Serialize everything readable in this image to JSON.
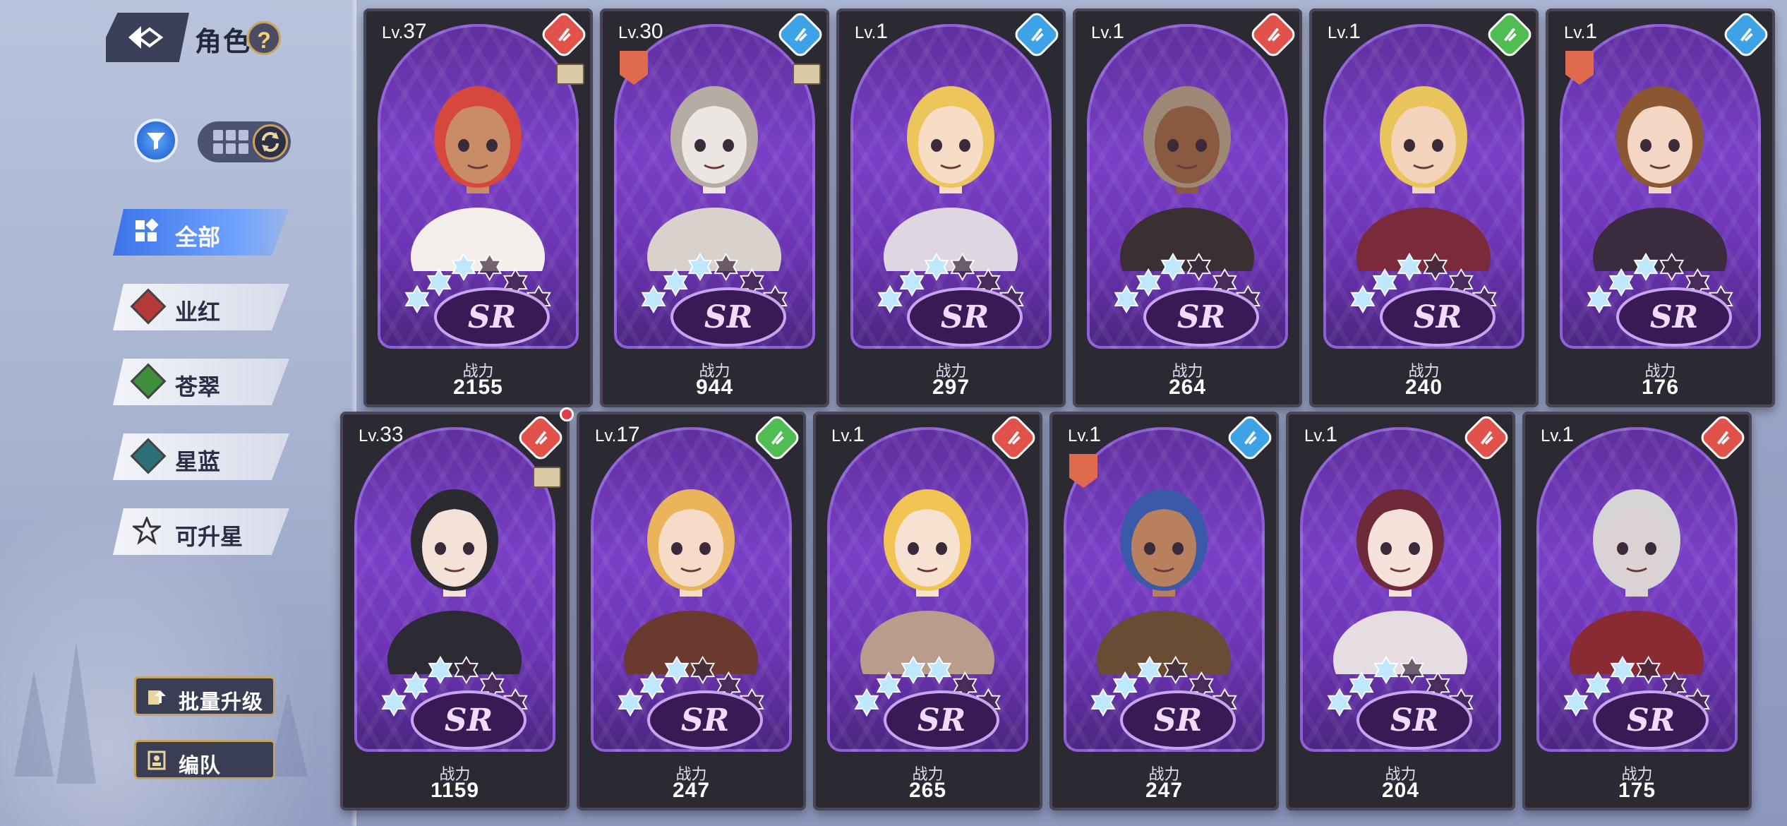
{
  "header": {
    "title": "角色",
    "help": "?"
  },
  "tabs": [
    {
      "label": "全部",
      "active": true
    },
    {
      "label": "业红",
      "color": "#b83a38"
    },
    {
      "label": "苍翠",
      "color": "#3f8f3a"
    },
    {
      "label": "星蓝",
      "color": "#2f6f7a"
    },
    {
      "label": "可升星"
    }
  ],
  "buttons": {
    "batch_upgrade": "批量升级",
    "formation": "编队"
  },
  "cards": [
    {
      "level_prefix": "Lv.",
      "level": "37",
      "element": "red",
      "has_ticket": true,
      "has_crest": false,
      "rarity": "SR",
      "stars": 3,
      "power_label": "战力",
      "power": "2155",
      "hair": "#d6473d",
      "skin": "#c98c67",
      "outfit": "#f3eee9"
    },
    {
      "level_prefix": "Lv.",
      "level": "30",
      "element": "blue",
      "has_ticket": true,
      "has_crest": true,
      "rarity": "SR",
      "stars": 3,
      "power_label": "战力",
      "power": "944",
      "hair": "#b6aca4",
      "skin": "#ece6e2",
      "outfit": "#d9d2cc"
    },
    {
      "level_prefix": "Lv.",
      "level": "1",
      "element": "blue",
      "has_ticket": false,
      "has_crest": false,
      "rarity": "SR",
      "stars": 3,
      "power_label": "战力",
      "power": "297",
      "hair": "#ecc65a",
      "skin": "#f7dcc6",
      "outfit": "#ded7e2"
    },
    {
      "level_prefix": "Lv.",
      "level": "1",
      "element": "red",
      "has_ticket": false,
      "has_crest": false,
      "rarity": "SR",
      "stars": 3,
      "power_label": "战力",
      "power": "264",
      "hair": "#9c8874",
      "skin": "#8a5a40",
      "outfit": "#3a2f32"
    },
    {
      "level_prefix": "Lv.",
      "level": "1",
      "element": "green",
      "has_ticket": false,
      "has_crest": false,
      "rarity": "SR",
      "stars": 3,
      "power_label": "战力",
      "power": "240",
      "hair": "#e9c45c",
      "skin": "#f3d3b9",
      "outfit": "#7b2a39"
    },
    {
      "level_prefix": "Lv.",
      "level": "1",
      "element": "blue",
      "has_ticket": false,
      "has_crest": true,
      "rarity": "SR",
      "stars": 3,
      "power_label": "战力",
      "power": "176",
      "hair": "#8a5732",
      "skin": "#f3d6c4",
      "outfit": "#3a2c3e"
    },
    {
      "level_prefix": "Lv.",
      "level": "33",
      "element": "red",
      "has_ticket": true,
      "has_crest": false,
      "rarity": "SR",
      "stars": 3,
      "power_label": "战力",
      "power": "1159",
      "hair": "#2a2a30",
      "skin": "#f4e2d8",
      "outfit": "#2c2a34",
      "notify": true
    },
    {
      "level_prefix": "Lv.",
      "level": "17",
      "element": "green",
      "has_ticket": false,
      "has_crest": false,
      "rarity": "SR",
      "stars": 3,
      "power_label": "战力",
      "power": "247",
      "hair": "#eab55a",
      "skin": "#f6dcc8",
      "outfit": "#6a3a2e"
    },
    {
      "level_prefix": "Lv.",
      "level": "1",
      "element": "red",
      "has_ticket": false,
      "has_crest": false,
      "rarity": "SR",
      "stars": 4,
      "power_label": "战力",
      "power": "265",
      "hair": "#f1c453",
      "skin": "#f7e1d1",
      "outfit": "#b99c8c"
    },
    {
      "level_prefix": "Lv.",
      "level": "1",
      "element": "blue",
      "has_ticket": false,
      "has_crest": true,
      "rarity": "SR",
      "stars": 3,
      "power_label": "战力",
      "power": "247",
      "hair": "#3a59a8",
      "skin": "#b98060",
      "outfit": "#6a4b34"
    },
    {
      "level_prefix": "Lv.",
      "level": "1",
      "element": "red",
      "has_ticket": false,
      "has_crest": false,
      "rarity": "SR",
      "stars": 3,
      "power_label": "战力",
      "power": "204",
      "hair": "#6e2a3a",
      "skin": "#f6e2da",
      "outfit": "#e6dde2"
    },
    {
      "level_prefix": "Lv.",
      "level": "1",
      "element": "red",
      "has_ticket": false,
      "has_crest": false,
      "rarity": "SR",
      "stars": 3,
      "power_label": "战力",
      "power": "175",
      "hair": "#d7d4d6",
      "skin": "#dcd2d4",
      "outfit": "#8a2a32"
    }
  ],
  "element_colors": {
    "red": "#e0524a",
    "blue": "#3ea2e6",
    "green": "#4fbd52"
  }
}
